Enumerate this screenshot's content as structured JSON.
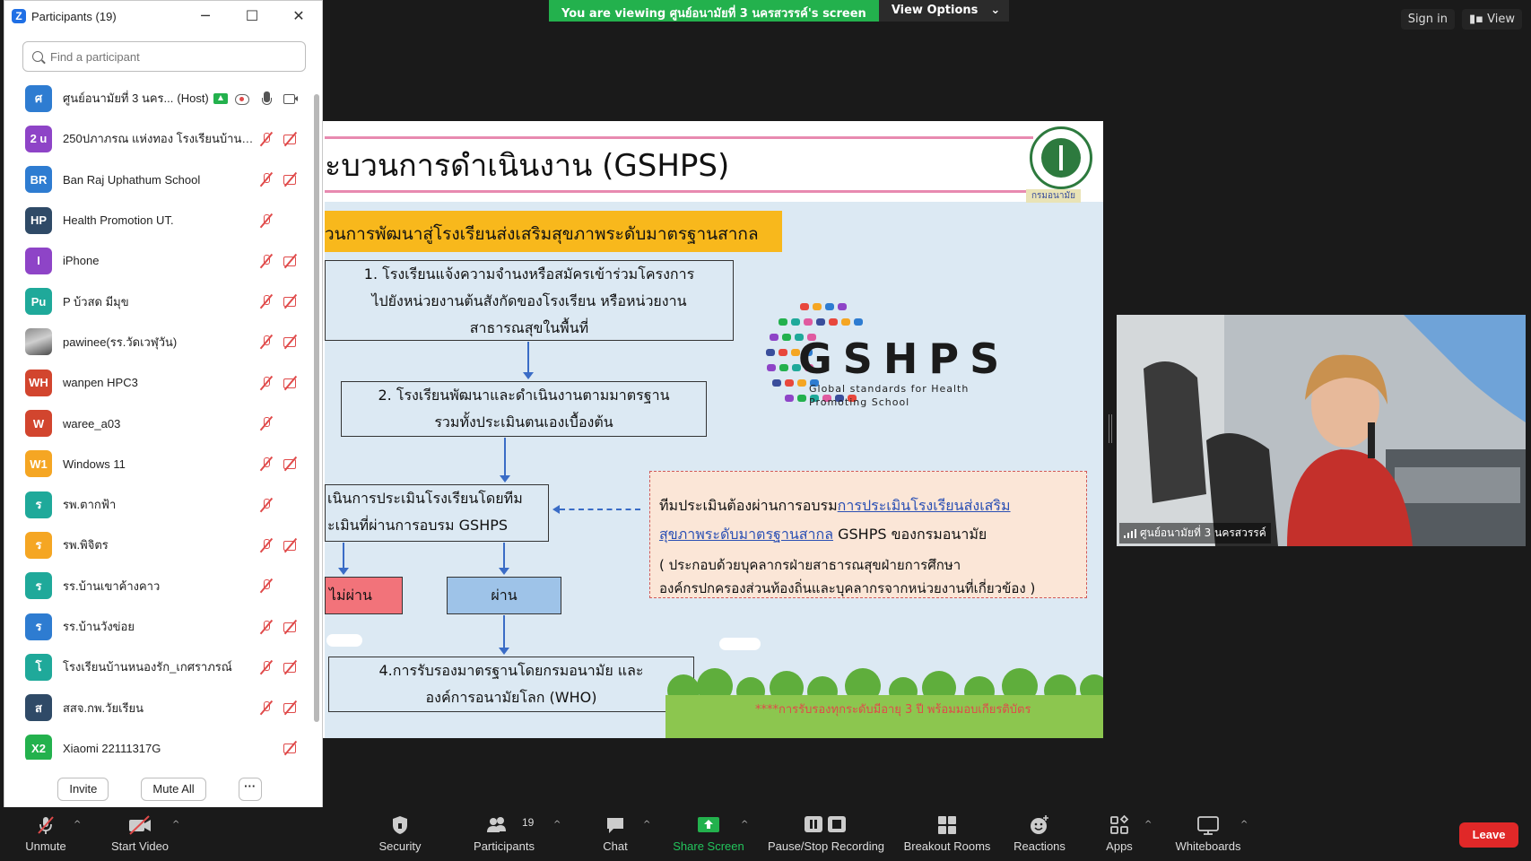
{
  "banner": {
    "viewing_text": "You are viewing ศูนย์อนามัยที่ 3 นครสวรรค์'s screen",
    "view_options": "View Options",
    "caret": "⌄"
  },
  "top_right": {
    "sign_in": "Sign in",
    "view": "View"
  },
  "participants_window": {
    "title": "Participants (19)",
    "controls": {
      "minimize": "─",
      "maximize": "☐",
      "close": "✕"
    },
    "search_placeholder": "Find a participant",
    "host_tag": "(Host)",
    "participants": [
      {
        "initials": "ศ",
        "name": "ศูนย์อนามัยที่ 3 นคร...",
        "avatar_color": "#2e7cd1",
        "mic": "on",
        "cam": "on",
        "host": true
      },
      {
        "initials": "2 u",
        "name": "250ปภาภรณ แห่งทอง โรงเรียนบ้านโคกก...",
        "avatar_color": "#8e44c7",
        "mic": "muted",
        "cam": "off"
      },
      {
        "initials": "BR",
        "name": "Ban Raj Uphathum School",
        "avatar_color": "#2e7cd1",
        "mic": "muted",
        "cam": "off"
      },
      {
        "initials": "HP",
        "name": "Health Promotion UT.",
        "avatar_color": "#2f4a67",
        "mic": "muted",
        "cam": "none"
      },
      {
        "initials": "I",
        "name": "iPhone",
        "avatar_color": "#8e44c7",
        "mic": "muted",
        "cam": "off"
      },
      {
        "initials": "Pu",
        "name": "P บ้วสด มีมุข",
        "avatar_color": "#1fa99a",
        "mic": "muted",
        "cam": "off"
      },
      {
        "initials": "",
        "name": "pawinee(รร.วัดเวฬุวัน)",
        "avatar_color": "photo",
        "mic": "muted",
        "cam": "off"
      },
      {
        "initials": "WH",
        "name": "wanpen HPC3",
        "avatar_color": "#d2452e",
        "mic": "muted",
        "cam": "off"
      },
      {
        "initials": "W",
        "name": "waree_a03",
        "avatar_color": "#d2452e",
        "mic": "muted",
        "cam": "none"
      },
      {
        "initials": "W1",
        "name": "Windows 11",
        "avatar_color": "#f5a623",
        "mic": "muted",
        "cam": "off"
      },
      {
        "initials": "ร",
        "name": "รพ.ตากฟ้า",
        "avatar_color": "#1fa99a",
        "mic": "muted",
        "cam": "none"
      },
      {
        "initials": "ร",
        "name": "รพ.พิจิตร",
        "avatar_color": "#f5a623",
        "mic": "muted",
        "cam": "off"
      },
      {
        "initials": "ร",
        "name": "รร.บ้านเขาค้างคาว",
        "avatar_color": "#1fa99a",
        "mic": "muted",
        "cam": "none"
      },
      {
        "initials": "ร",
        "name": "รร.บ้านวังข่อย",
        "avatar_color": "#2e7cd1",
        "mic": "muted",
        "cam": "off"
      },
      {
        "initials": "โ",
        "name": "โรงเรียนบ้านหนองรัก_เกศราภรณ์",
        "avatar_color": "#1fa99a",
        "mic": "muted",
        "cam": "off"
      },
      {
        "initials": "ส",
        "name": "สสจ.กพ.วัยเรียน",
        "avatar_color": "#2f4a67",
        "mic": "muted",
        "cam": "off"
      },
      {
        "initials": "X2",
        "name": "Xiaomi 22111317G",
        "avatar_color": "#23b14d",
        "mic": "none",
        "cam": "off"
      }
    ],
    "footer": {
      "invite": "Invite",
      "mute_all": "Mute All",
      "more": "···"
    }
  },
  "slide": {
    "title": "ะบวนการดำเนินงาน (GSHPS)",
    "seal_caption": "กรมอนามัย",
    "yellow_heading": "วนการพัฒนาสู่โรงเรียนส่งเสริมสุขภาพระดับมาตรฐานสากล",
    "step1": [
      "1. โรงเรียนแจ้งความจำนงหรือสมัครเข้าร่วมโครงการ",
      "ไปยังหน่วยงานต้นสังกัดของโรงเรียน หรือหน่วยงาน",
      "สาธารณสุขในพื้นที่"
    ],
    "step2": [
      "2. โรงเรียนพัฒนาและดำเนินงานตามมาตรฐาน",
      "รวมทั้งประเมินตนเองเบื้องต้น"
    ],
    "step3": [
      "เนินการประเมินโรงเรียนโดยทีม",
      "ะเมินที่ผ่านการอบรม GSHPS"
    ],
    "fail_label": "ไม่ผ่าน",
    "pass_label": "ผ่าน",
    "step4": [
      "4.การรับรองมาตรฐานโดยกรมอนามัย และ",
      "องค์การอนามัยโลก (WHO)"
    ],
    "note": {
      "lead": "ทีมประเมินต้องผ่านการอบรม",
      "link1": "การประเมินโรงเรียนส่งเสริม",
      "link2": "สุขภาพระดับมาตรฐานสากล",
      "tail": " GSHPS ของกรมอนามัย",
      "detail1": "( ประกอบด้วยบุคลากรฝ่ายสาธารณสุขฝ่ายการศึกษา",
      "detail2": "องค์กรปกครองส่วนท้องถิ่นและบุคลากรจากหน่วยงานที่เกี่ยวข้อง )"
    },
    "gshps_word": "GSHPS",
    "gshps_sub1": "Global standards for Health",
    "gshps_sub2": "Promoting School",
    "footnote": "****การรับรองทุกระดับมีอายุ 3 ปี พร้อมมอบเกียรติบัตร"
  },
  "video": {
    "label": "ศูนย์อนามัยที่ 3 นครสวรรค์"
  },
  "toolbar": {
    "unmute": "Unmute",
    "start_video": "Start Video",
    "security": "Security",
    "participants": "Participants",
    "participants_count": "19",
    "chat": "Chat",
    "share_screen": "Share Screen",
    "pause_stop_recording": "Pause/Stop Recording",
    "breakout_rooms": "Breakout Rooms",
    "reactions": "Reactions",
    "apps": "Apps",
    "whiteboards": "Whiteboards",
    "leave": "Leave",
    "caret": "^"
  }
}
